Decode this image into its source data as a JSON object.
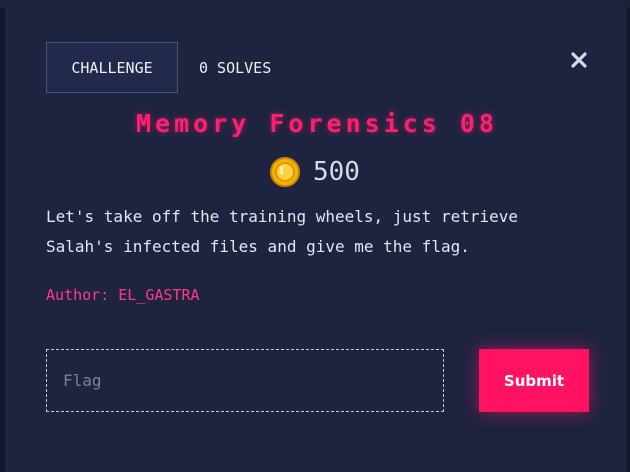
{
  "tabs": {
    "challenge_label": "CHALLENGE",
    "solves_label": "0 SOLVES"
  },
  "challenge": {
    "title": "Memory Forensics 08",
    "points": "500",
    "description_line1": "Let's take off the training wheels, just retrieve",
    "description_line2": "Salah's infected files and give me the flag.",
    "author": "Author: EL_GASTRA"
  },
  "form": {
    "flag_placeholder": "Flag",
    "flag_value": "",
    "submit_label": "Submit"
  },
  "icons": {
    "close": "close-icon",
    "coin": "coin-icon"
  },
  "colors": {
    "accent": "#ff1262",
    "title": "#ff1f6b",
    "author": "#ff3a84",
    "background": "#1e2440"
  }
}
